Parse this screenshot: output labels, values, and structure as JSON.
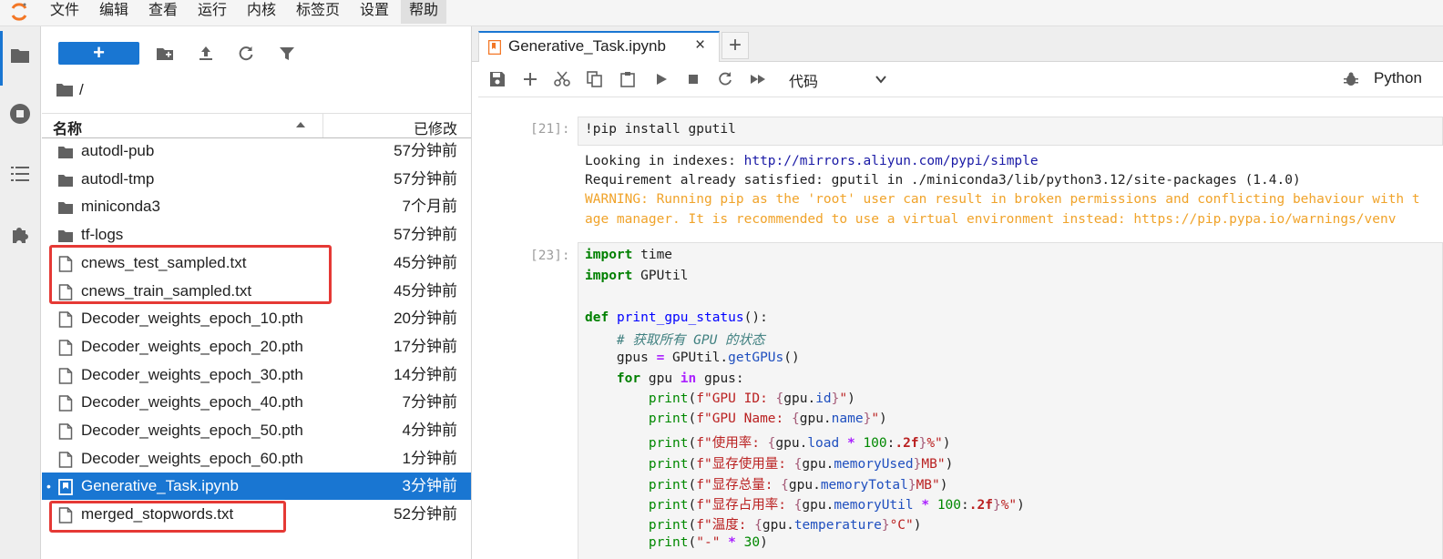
{
  "menubar": {
    "items": [
      "文件",
      "编辑",
      "查看",
      "运行",
      "内核",
      "标签页",
      "设置",
      "帮助"
    ],
    "active": "帮助"
  },
  "filebrowser": {
    "breadcrumb": "/",
    "columns": {
      "name": "名称",
      "modified": "已修改"
    },
    "files": [
      {
        "name": "autodl-pub",
        "modified": "57分钟前",
        "type": "folder"
      },
      {
        "name": "autodl-tmp",
        "modified": "57分钟前",
        "type": "folder"
      },
      {
        "name": "miniconda3",
        "modified": "7个月前",
        "type": "folder"
      },
      {
        "name": "tf-logs",
        "modified": "57分钟前",
        "type": "folder"
      },
      {
        "name": "cnews_test_sampled.txt",
        "modified": "45分钟前",
        "type": "file"
      },
      {
        "name": "cnews_train_sampled.txt",
        "modified": "45分钟前",
        "type": "file"
      },
      {
        "name": "Decoder_weights_epoch_10.pth",
        "modified": "20分钟前",
        "type": "file"
      },
      {
        "name": "Decoder_weights_epoch_20.pth",
        "modified": "17分钟前",
        "type": "file"
      },
      {
        "name": "Decoder_weights_epoch_30.pth",
        "modified": "14分钟前",
        "type": "file"
      },
      {
        "name": "Decoder_weights_epoch_40.pth",
        "modified": "7分钟前",
        "type": "file"
      },
      {
        "name": "Decoder_weights_epoch_50.pth",
        "modified": "4分钟前",
        "type": "file"
      },
      {
        "name": "Decoder_weights_epoch_60.pth",
        "modified": "1分钟前",
        "type": "file"
      },
      {
        "name": "Generative_Task.ipynb",
        "modified": "3分钟前",
        "type": "notebook",
        "selected": true
      },
      {
        "name": "merged_stopwords.txt",
        "modified": "52分钟前",
        "type": "file"
      }
    ]
  },
  "notebook": {
    "tab_title": "Generative_Task.ipynb",
    "tab_close": "×",
    "tab_add": "+",
    "cell_type": "代码",
    "kernel": "Python",
    "cells": [
      {
        "prompt": "[21]:",
        "code": "!pip install gputil"
      },
      {
        "prompt": "[23]:"
      }
    ],
    "output1": {
      "line1_prefix": "Looking in indexes: ",
      "line1_link": "http://mirrors.aliyun.com/pypi/simple",
      "line2": "Requirement already satisfied: gputil in ./miniconda3/lib/python3.12/site-packages (1.4.0)",
      "warn1": "WARNING: Running pip as the 'root' user can result in broken permissions and conflicting behaviour with t",
      "warn2": "age manager. It is recommended to use a virtual environment instead: https://pip.pypa.io/warnings/venv"
    }
  },
  "colors": {
    "accent": "#1976d2",
    "highlight_box": "#e53935",
    "warning_text": "#f0a32a"
  },
  "icons": {
    "logo": "jupyter-logo-icon",
    "leftbar": [
      "folder-icon",
      "running-icon",
      "toc-icon",
      "extension-icon"
    ],
    "file_toolbar": [
      "new-folder-icon",
      "upload-icon",
      "refresh-icon",
      "filter-icon"
    ],
    "nb_toolbar": [
      "save-icon",
      "add-cell-icon",
      "cut-icon",
      "copy-icon",
      "paste-icon",
      "run-icon",
      "stop-icon",
      "restart-icon",
      "fast-forward-icon"
    ]
  }
}
